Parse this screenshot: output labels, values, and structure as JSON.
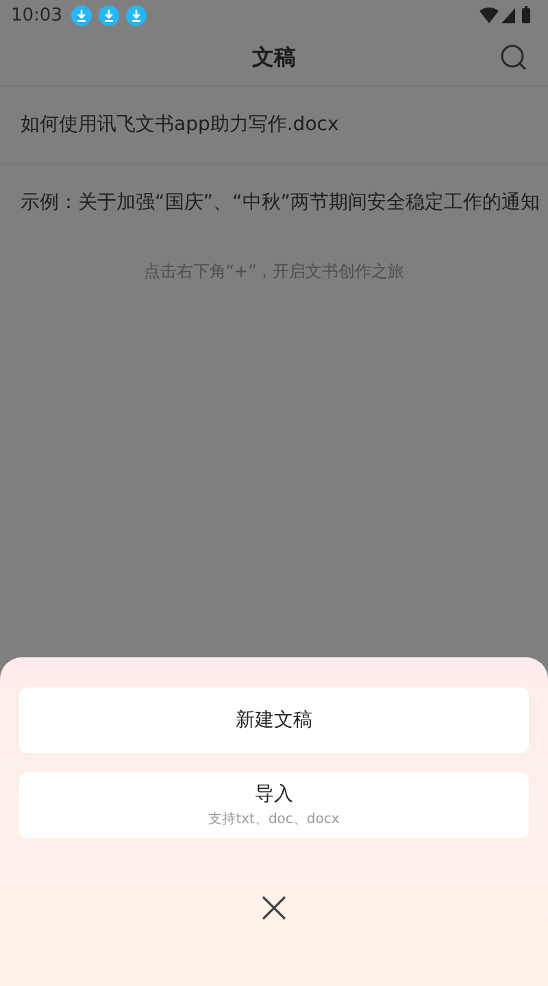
{
  "status_bar": {
    "time": "10:03",
    "notifications": [
      {
        "kind": "download"
      },
      {
        "kind": "download"
      },
      {
        "kind": "download"
      }
    ]
  },
  "header": {
    "title": "文稿"
  },
  "documents": [
    {
      "name": "如何使用讯飞文书app助力写作.docx"
    },
    {
      "name": "示例：关于加强“国庆”、“中秋”两节期间安全稳定工作的通知"
    }
  ],
  "hint": "点击右下角“+”，开启文书创作之旅",
  "sheet": {
    "options": [
      {
        "label": "新建文稿"
      },
      {
        "label": "导入",
        "subtitle": "支持txt、doc、docx"
      }
    ]
  }
}
